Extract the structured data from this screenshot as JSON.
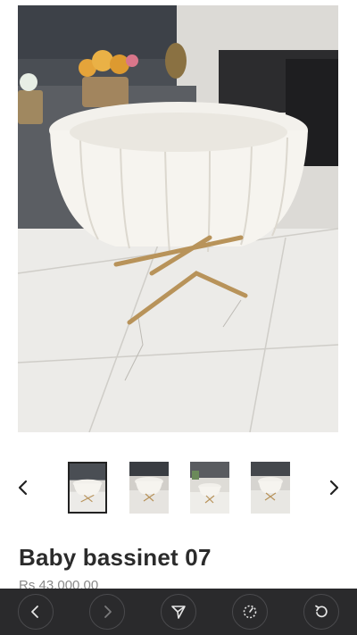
{
  "product": {
    "title": "Baby bassinet 07",
    "price": "Rs 43,000.00"
  },
  "gallery": {
    "thumbnail_count": 4,
    "active_index": 0,
    "prev_icon": "chevron-left-icon",
    "next_icon": "chevron-right-icon"
  },
  "toolbar": {
    "buttons": [
      {
        "icon": "back-arrow-icon"
      },
      {
        "icon": "forward-arrow-icon"
      },
      {
        "icon": "send-icon"
      },
      {
        "icon": "progress-dial-icon"
      },
      {
        "icon": "refresh-icon"
      }
    ]
  },
  "colors": {
    "toolbar_bg": "#2a2a2c",
    "title": "#2b2b2b",
    "price": "#8a8a8a"
  }
}
